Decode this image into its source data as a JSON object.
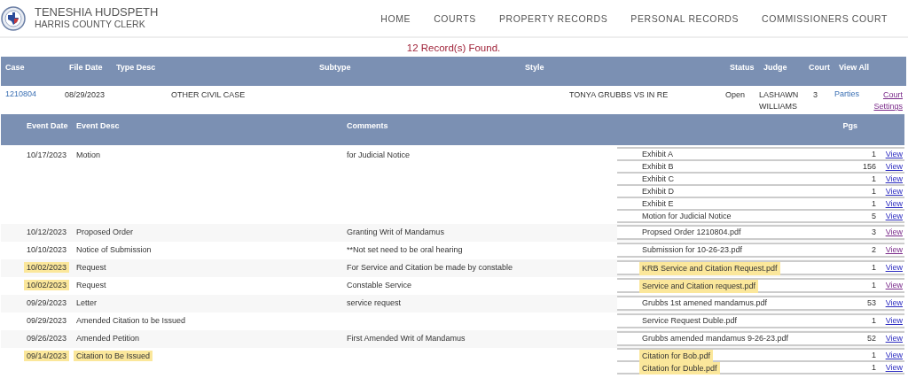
{
  "header": {
    "title": "TENESHIA HUDSPETH",
    "subtitle": "HARRIS COUNTY CLERK",
    "nav": [
      "HOME",
      "COURTS",
      "PROPERTY RECORDS",
      "PERSONAL RECORDS",
      "COMMISSIONERS COURT"
    ]
  },
  "record_count": "12 Record(s) Found.",
  "case_table": {
    "columns": [
      "Case",
      "File Date",
      "Type Desc",
      "Subtype",
      "Style",
      "Status",
      "Judge",
      "Court",
      "View All",
      ""
    ],
    "row": {
      "case": "1210804",
      "file_date": "08/29/2023",
      "type_desc": "OTHER CIVIL CASE",
      "style": "TONYA GRUBBS VS IN RE",
      "status": "Open",
      "judge": "LASHAWN WILLIAMS",
      "court": "3",
      "parties": {
        "label": "Parties",
        "visited": false
      },
      "court_settings": {
        "label": "Court Settings",
        "visited": true
      }
    }
  },
  "events": {
    "columns": [
      "Event Date",
      "Event Desc",
      "Comments",
      "Pgs"
    ],
    "rows": [
      {
        "date": "10/17/2023",
        "desc": "Motion",
        "comments": "for Judicial Notice",
        "date_highlighted": false,
        "desc_highlighted": false,
        "docs": [
          {
            "name": "Exhibit A",
            "pages": "1",
            "link": "View",
            "visited": false,
            "highlighted": false
          },
          {
            "name": "Exhibit B",
            "pages": "156",
            "link": "View",
            "visited": false,
            "highlighted": false
          },
          {
            "name": "Exhibit C",
            "pages": "1",
            "link": "View",
            "visited": false,
            "highlighted": false
          },
          {
            "name": "Exhibit D",
            "pages": "1",
            "link": "View",
            "visited": false,
            "highlighted": false
          },
          {
            "name": "Exhibit E",
            "pages": "1",
            "link": "View",
            "visited": false,
            "highlighted": false
          },
          {
            "name": "Motion for Judicial Notice",
            "pages": "5",
            "link": "View",
            "visited": false,
            "highlighted": false
          }
        ]
      },
      {
        "date": "10/12/2023",
        "desc": "Proposed Order",
        "comments": "Granting Writ of Mandamus",
        "date_highlighted": false,
        "desc_highlighted": false,
        "docs": [
          {
            "name": "Propsed Order 1210804.pdf",
            "pages": "3",
            "link": "View",
            "visited": true,
            "highlighted": false
          }
        ]
      },
      {
        "date": "10/10/2023",
        "desc": "Notice of Submission",
        "comments": "**Not set need to be oral hearing",
        "date_highlighted": false,
        "desc_highlighted": false,
        "docs": [
          {
            "name": "Submission for 10-26-23.pdf",
            "pages": "2",
            "link": "View",
            "visited": true,
            "highlighted": false
          }
        ]
      },
      {
        "date": "10/02/2023",
        "desc": "Request",
        "comments": "For Service and Citation be made by constable",
        "date_highlighted": true,
        "desc_highlighted": false,
        "docs": [
          {
            "name": "KRB Service and Citation Request.pdf",
            "pages": "1",
            "link": "View",
            "visited": false,
            "highlighted": true
          }
        ]
      },
      {
        "date": "10/02/2023",
        "desc": "Request",
        "comments": "Constable Service",
        "date_highlighted": true,
        "desc_highlighted": false,
        "docs": [
          {
            "name": "Service and Citation request.pdf",
            "pages": "1",
            "link": "View",
            "visited": true,
            "highlighted": true
          }
        ]
      },
      {
        "date": "09/29/2023",
        "desc": "Letter",
        "comments": "service request",
        "date_highlighted": false,
        "desc_highlighted": false,
        "docs": [
          {
            "name": "Grubbs 1st amened mandamus.pdf",
            "pages": "53",
            "link": "View",
            "visited": false,
            "highlighted": false
          }
        ]
      },
      {
        "date": "09/29/2023",
        "desc": "Amended Citation to be Issued",
        "date_highlighted": false,
        "desc_highlighted": false,
        "docs": [
          {
            "name": "Service Request Duble.pdf",
            "pages": "1",
            "link": "View",
            "visited": false,
            "highlighted": false
          }
        ]
      },
      {
        "date": "09/26/2023",
        "desc": "Amended Petition",
        "comments": "First Amended Writ of Mandamus",
        "date_highlighted": false,
        "desc_highlighted": false,
        "docs": [
          {
            "name": "Grubbs amended mandamus 9-26-23.pdf",
            "pages": "52",
            "link": "View",
            "visited": false,
            "highlighted": false
          }
        ]
      },
      {
        "date": "09/14/2023",
        "desc": "Citation to Be Issued",
        "date_highlighted": true,
        "desc_highlighted": true,
        "docs": [
          {
            "name": "Citation for Bob.pdf",
            "pages": "1",
            "link": "View",
            "visited": false,
            "highlighted": true
          },
          {
            "name": "Citation for Duble.pdf",
            "pages": "1",
            "link": "View",
            "visited": false,
            "highlighted": true
          }
        ]
      }
    ]
  }
}
